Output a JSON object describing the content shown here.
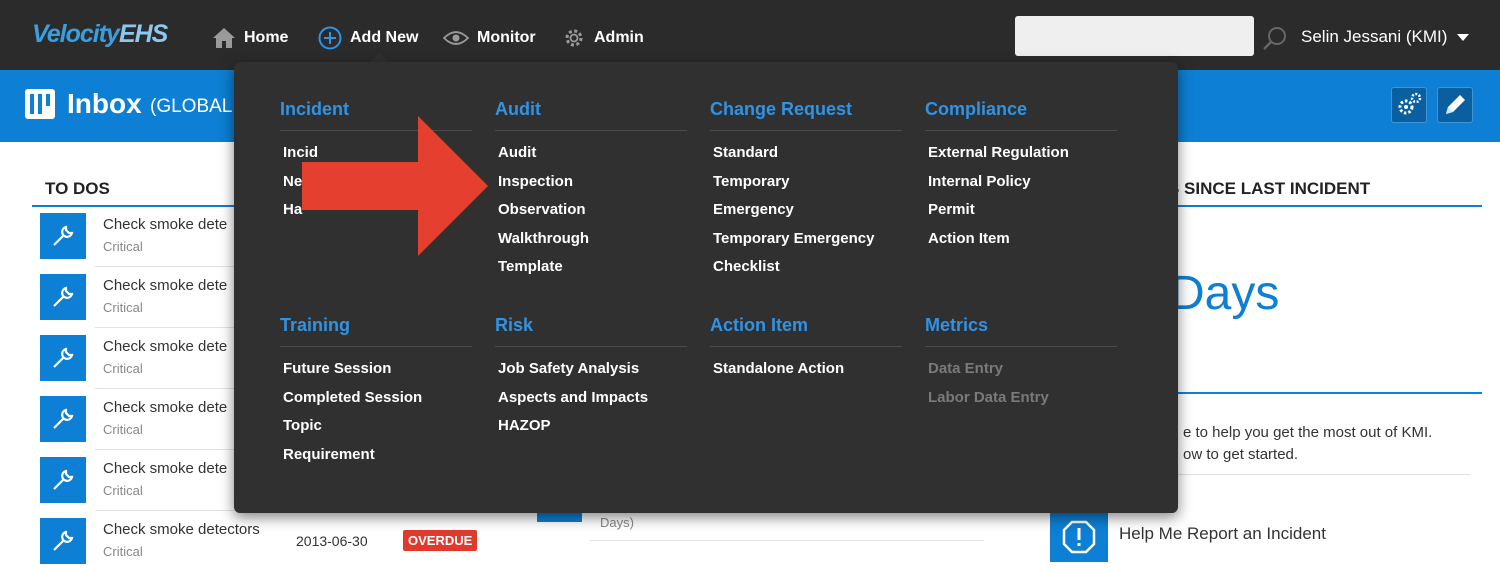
{
  "app": {
    "logo_main": "Velocity",
    "logo_ehs": "EHS"
  },
  "nav": {
    "home": "Home",
    "add_new": "Add New",
    "monitor": "Monitor",
    "admin": "Admin",
    "search_placeholder": "",
    "user": "Selin Jessani (KMI)"
  },
  "header": {
    "title": "Inbox",
    "scope": "(GLOBAL C"
  },
  "todos": {
    "title": "TO DOS",
    "items": [
      {
        "title": "Check smoke dete",
        "sub": "Critical"
      },
      {
        "title": "Check smoke dete",
        "sub": "Critical"
      },
      {
        "title": "Check smoke dete",
        "sub": "Critical"
      },
      {
        "title": "Check smoke dete",
        "sub": "Critical"
      },
      {
        "title": "Check smoke dete",
        "sub": "Critical"
      },
      {
        "title": "Check smoke detectors",
        "sub": "Critical",
        "date": "2013-06-30",
        "status": "OVERDUE"
      }
    ]
  },
  "middle": {
    "days_fragment": "Days)"
  },
  "right": {
    "title": "S SINCE LAST INCIDENT",
    "days_text": "Days",
    "help_line1": "e to help you get the most out of KMI.",
    "help_line2": "ow to get started.",
    "help_link": "Help Me Report an Incident"
  },
  "menu": {
    "incident": {
      "title": "Incident",
      "items": [
        "Incid",
        "Ne",
        "Ha"
      ]
    },
    "audit": {
      "title": "Audit",
      "items": [
        "Audit",
        "Inspection",
        "Observation",
        "Walkthrough",
        "Template"
      ]
    },
    "change_request": {
      "title": "Change Request",
      "items": [
        "Standard",
        "Temporary",
        "Emergency",
        "Temporary Emergency",
        "Checklist"
      ]
    },
    "compliance": {
      "title": "Compliance",
      "items": [
        "External Regulation",
        "Internal Policy",
        "Permit",
        "Action Item"
      ]
    },
    "training": {
      "title": "Training",
      "items": [
        "Future Session",
        "Completed Session",
        "Topic",
        "Requirement"
      ]
    },
    "risk": {
      "title": "Risk",
      "items": [
        "Job Safety Analysis",
        "Aspects and Impacts",
        "HAZOP"
      ]
    },
    "action_item": {
      "title": "Action Item",
      "items": [
        "Standalone Action"
      ]
    },
    "metrics": {
      "title": "Metrics",
      "items": [
        "Data Entry",
        "Labor Data Entry"
      ]
    }
  },
  "colors": {
    "brand_blue": "#0d7fd4",
    "menu_link_blue": "#2f93e6",
    "nav_bg": "#2b2b2b",
    "menu_bg": "#303030",
    "overdue_red": "#e03a2d",
    "arrow_red": "#e5402f"
  }
}
